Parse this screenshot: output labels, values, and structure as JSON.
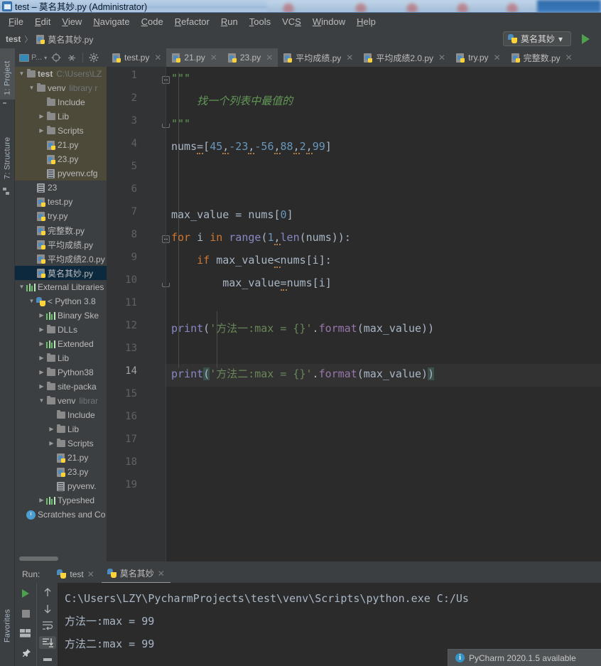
{
  "window": {
    "title": "test – 莫名其妙.py (Administrator)",
    "icon": "pycharm-icon"
  },
  "menubar": [
    {
      "label": "File",
      "mnemonic": "F"
    },
    {
      "label": "Edit",
      "mnemonic": "E"
    },
    {
      "label": "View",
      "mnemonic": "V"
    },
    {
      "label": "Navigate",
      "mnemonic": "N"
    },
    {
      "label": "Code",
      "mnemonic": "C"
    },
    {
      "label": "Refactor",
      "mnemonic": "R"
    },
    {
      "label": "Run",
      "mnemonic": "R"
    },
    {
      "label": "Tools",
      "mnemonic": "T"
    },
    {
      "label": "VCS",
      "mnemonic": "S"
    },
    {
      "label": "Window",
      "mnemonic": "W"
    },
    {
      "label": "Help",
      "mnemonic": "H"
    }
  ],
  "navbar": {
    "project": "test",
    "separator": "〉",
    "file": "莫名其妙.py"
  },
  "run_config": {
    "name": "莫名其妙",
    "chevron": "▾",
    "run_button": "run-icon"
  },
  "left_tool_window_bars": [
    {
      "label": "1: Project",
      "active": true
    },
    {
      "label": "7: Structure",
      "active": false
    }
  ],
  "bottom_left_bars": [
    {
      "label": "Favorites",
      "active": false
    }
  ],
  "project_panel": {
    "toolbar": {
      "scope_label": "P...",
      "scope_chevron": "▾",
      "locate_icon": "crosshair-icon",
      "collapse_icon": "collapse-all-icon",
      "settings_icon": "gear-icon"
    },
    "tree": [
      {
        "indent": 0,
        "arrow": "▼",
        "icon": "folder-icon",
        "label": "test",
        "bold": true,
        "dim": "C:\\Users\\LZ",
        "group": true
      },
      {
        "indent": 1,
        "arrow": "▼",
        "icon": "folder-icon",
        "label": "venv",
        "dim": "library r",
        "group": true
      },
      {
        "indent": 2,
        "arrow": "",
        "icon": "folder-icon",
        "label": "Include",
        "dim": "",
        "group": true
      },
      {
        "indent": 2,
        "arrow": "▶",
        "icon": "folder-icon",
        "label": "Lib",
        "dim": "",
        "group": true
      },
      {
        "indent": 2,
        "arrow": "▶",
        "icon": "folder-icon",
        "label": "Scripts",
        "dim": "",
        "group": true
      },
      {
        "indent": 2,
        "arrow": "",
        "icon": "python-file-icon",
        "label": "21.py",
        "dim": "",
        "group": true
      },
      {
        "indent": 2,
        "arrow": "",
        "icon": "python-file-icon",
        "label": "23.py",
        "dim": "",
        "group": true
      },
      {
        "indent": 2,
        "arrow": "",
        "icon": "text-file-icon",
        "label": "pyvenv.cfg",
        "dim": "",
        "group": true
      },
      {
        "indent": 1,
        "arrow": "",
        "icon": "text-file-icon",
        "label": "23",
        "dim": ""
      },
      {
        "indent": 1,
        "arrow": "",
        "icon": "python-file-icon",
        "label": "test.py",
        "dim": ""
      },
      {
        "indent": 1,
        "arrow": "",
        "icon": "python-file-icon",
        "label": "try.py",
        "dim": ""
      },
      {
        "indent": 1,
        "arrow": "",
        "icon": "python-file-icon",
        "label": "完整数.py",
        "dim": ""
      },
      {
        "indent": 1,
        "arrow": "",
        "icon": "python-file-icon",
        "label": "平均成绩.py",
        "dim": ""
      },
      {
        "indent": 1,
        "arrow": "",
        "icon": "python-file-icon",
        "label": "平均成绩2.0.py",
        "dim": ""
      },
      {
        "indent": 1,
        "arrow": "",
        "icon": "python-file-icon",
        "label": "莫名其妙.py",
        "dim": "",
        "selected": true
      },
      {
        "indent": 0,
        "arrow": "▼",
        "icon": "library-icon",
        "label": "External Libraries",
        "dim": ""
      },
      {
        "indent": 1,
        "arrow": "▼",
        "icon": "python-icon",
        "label": "< Python 3.8",
        "dim": ""
      },
      {
        "indent": 2,
        "arrow": "▶",
        "icon": "library-icon",
        "label": "Binary Ske",
        "dim": ""
      },
      {
        "indent": 2,
        "arrow": "▶",
        "icon": "folder-icon",
        "label": "DLLs",
        "dim": ""
      },
      {
        "indent": 2,
        "arrow": "▶",
        "icon": "library-icon",
        "label": "Extended ",
        "dim": ""
      },
      {
        "indent": 2,
        "arrow": "▶",
        "icon": "folder-icon",
        "label": "Lib",
        "dim": ""
      },
      {
        "indent": 2,
        "arrow": "▶",
        "icon": "folder-icon",
        "label": "Python38",
        "dim": ""
      },
      {
        "indent": 2,
        "arrow": "▶",
        "icon": "folder-icon",
        "label": "site-packa",
        "dim": ""
      },
      {
        "indent": 2,
        "arrow": "▼",
        "icon": "folder-icon",
        "label": "venv",
        "dim": "librar"
      },
      {
        "indent": 3,
        "arrow": "",
        "icon": "folder-icon",
        "label": "Include",
        "dim": ""
      },
      {
        "indent": 3,
        "arrow": "▶",
        "icon": "folder-icon",
        "label": "Lib",
        "dim": ""
      },
      {
        "indent": 3,
        "arrow": "▶",
        "icon": "folder-icon",
        "label": "Scripts",
        "dim": ""
      },
      {
        "indent": 3,
        "arrow": "",
        "icon": "python-file-icon",
        "label": "21.py",
        "dim": ""
      },
      {
        "indent": 3,
        "arrow": "",
        "icon": "python-file-icon",
        "label": "23.py",
        "dim": ""
      },
      {
        "indent": 3,
        "arrow": "",
        "icon": "text-file-icon",
        "label": "pyvenv.",
        "dim": ""
      },
      {
        "indent": 2,
        "arrow": "▶",
        "icon": "library-icon",
        "label": "Typeshed ",
        "dim": ""
      },
      {
        "indent": 0,
        "arrow": "",
        "icon": "scratches-icon",
        "label": "Scratches and Co",
        "dim": ""
      }
    ]
  },
  "editor_tabs": [
    {
      "label": "test.py",
      "active": false
    },
    {
      "label": "21.py",
      "active": true
    },
    {
      "label": "23.py",
      "active": true
    },
    {
      "label": "平均成绩.py",
      "active": false
    },
    {
      "label": "平均成绩2.0.py",
      "active": false
    },
    {
      "label": "try.py",
      "active": false
    },
    {
      "label": "完整数.py",
      "active": false
    }
  ],
  "editor": {
    "current_line": 14,
    "line_numbers": [
      1,
      2,
      3,
      4,
      5,
      6,
      7,
      8,
      9,
      10,
      11,
      12,
      13,
      14,
      15,
      16,
      17,
      18,
      19
    ],
    "code_lines": [
      "\"\"\"",
      "    找一个列表中最值的",
      "\"\"\"",
      "nums=[45,-23,-56,88,2,99]",
      "",
      "",
      "max_value = nums[0]",
      "for i in range(1,len(nums)):",
      "    if max_value<nums[i]:",
      "        max_value=nums[i]",
      "",
      "print('方法一:max = {}'.format(max_value))",
      "",
      "print('方法二:max = {}'.format(max_value))",
      "",
      "",
      "",
      "",
      ""
    ]
  },
  "run_panel": {
    "label": "Run:",
    "tabs": [
      {
        "label": "test",
        "active": false
      },
      {
        "label": "莫名其妙",
        "active": true
      }
    ],
    "toolbar": {
      "rerun": "run-icon",
      "stop": "stop-icon",
      "layout": "layout-icon",
      "pin": "pin-icon",
      "up": "arrow-up-icon",
      "down": "arrow-down-icon",
      "soft_wrap": "soft-wrap-icon",
      "scroll_end": "scroll-to-end-icon",
      "print": "print-icon"
    },
    "console_lines": [
      "C:\\Users\\LZY\\PycharmProjects\\test\\venv\\Scripts\\python.exe C:/Us",
      "方法一:max = 99",
      "方法二:max = 99"
    ]
  },
  "notification": {
    "icon": "info-icon",
    "text": "PyCharm 2020.1.5 available"
  },
  "colors": {
    "panel_bg": "#3c3f41",
    "editor_bg": "#2b2b2b",
    "gutter_bg": "#313335",
    "selection_blue": "#0d293e",
    "group_brown": "#4e4a3a",
    "keyword_orange": "#cc7832",
    "string_green": "#6a8759",
    "comment_green": "#629755",
    "number_blue": "#6897bb",
    "function_yellow": "#ffc66d",
    "text_fg": "#a9b7c6",
    "run_green": "#4ca14c",
    "accent_blue": "#3592c4"
  }
}
